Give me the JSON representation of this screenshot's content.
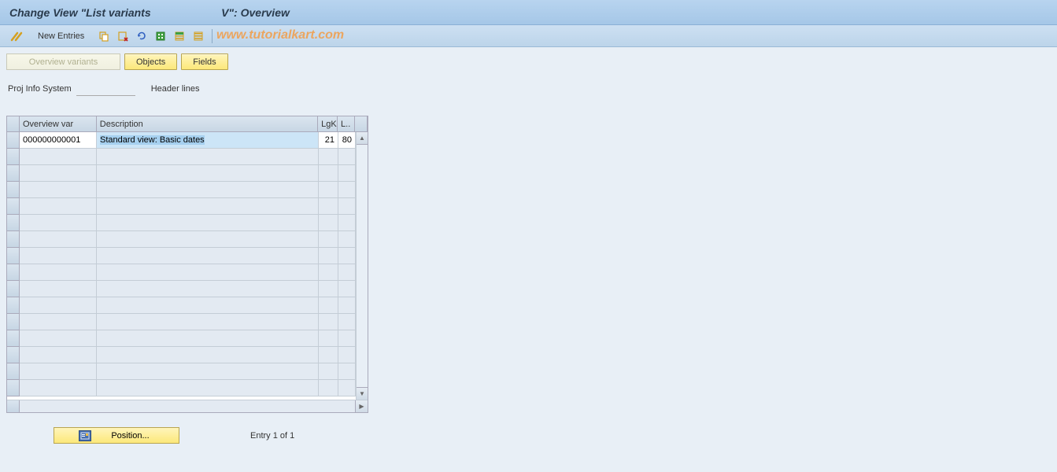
{
  "title_bar": {
    "text": "Change View \"List variants                       V\": Overview"
  },
  "toolbar": {
    "new_entries_label": "New Entries",
    "watermark_text": "www.tutorialkart.com",
    "icons": {
      "pencils": "pencils-icon",
      "copy": "copy-icon",
      "delete": "delete-icon",
      "undo": "undo-icon",
      "select_all": "select-all-icon",
      "select_block": "select-block-icon",
      "deselect": "deselect-icon"
    }
  },
  "button_row": {
    "overview_variants": "Overview variants",
    "objects": "Objects",
    "fields": "Fields"
  },
  "info_line": {
    "label": "Proj Info System",
    "value": "",
    "text": "Header lines"
  },
  "grid": {
    "headers": {
      "overview_var": "Overview var",
      "description": "Description",
      "lgk": "LgK",
      "l": "L.."
    },
    "rows": [
      {
        "overview_var": "000000000001",
        "description": "Standard view: Basic dates",
        "lgk": "21",
        "l": "80"
      }
    ]
  },
  "footer": {
    "position_label": "Position...",
    "entry_status": "Entry 1 of 1"
  }
}
